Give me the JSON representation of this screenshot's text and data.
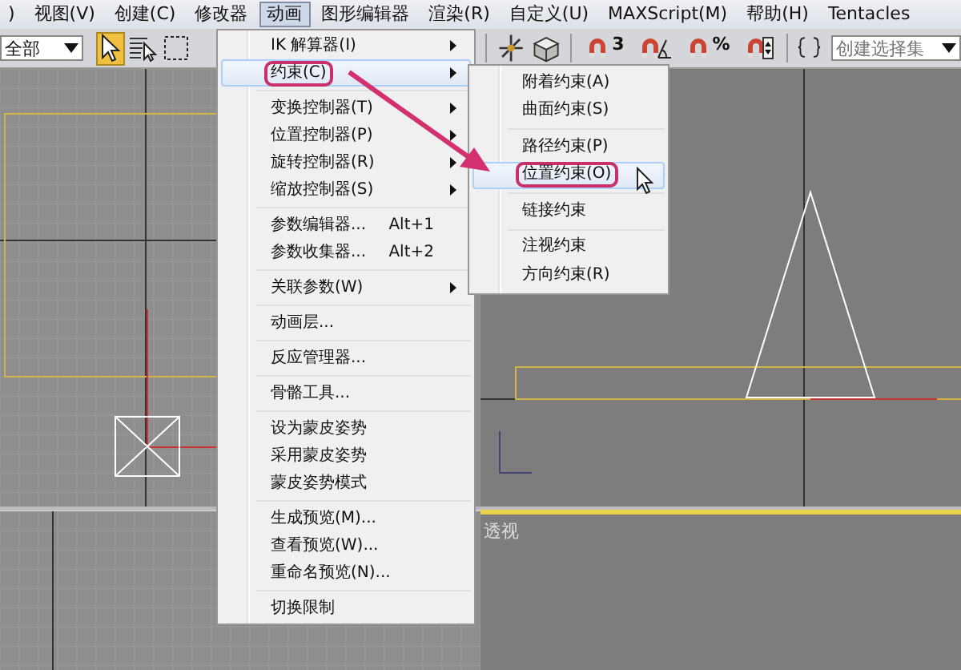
{
  "menubar": {
    "items": [
      {
        "label": ")",
        "selected": false
      },
      {
        "label": "视图(V)",
        "selected": false
      },
      {
        "label": "创建(C)",
        "selected": false
      },
      {
        "label": "修改器",
        "selected": false
      },
      {
        "label": "动画",
        "selected": true
      },
      {
        "label": "图形编辑器",
        "selected": false
      },
      {
        "label": "渲染(R)",
        "selected": false
      },
      {
        "label": "自定义(U)",
        "selected": false
      },
      {
        "label": "MAXScript(M)",
        "selected": false
      },
      {
        "label": "帮助(H)",
        "selected": false
      },
      {
        "label": "Tentacles",
        "selected": false
      }
    ]
  },
  "toolbar": {
    "selection_filter": "全部",
    "tools": [
      {
        "kind": "select",
        "selected": true
      },
      {
        "kind": "select-by-name",
        "selected": false
      },
      {
        "kind": "region",
        "selected": false
      }
    ],
    "snap_tools": [
      {
        "kind": "snap",
        "label": "3"
      },
      {
        "kind": "angle"
      },
      {
        "kind": "percent",
        "label": "%"
      },
      {
        "kind": "spinner"
      }
    ],
    "named_selection": {
      "placeholder": "创建选择集"
    }
  },
  "menu": {
    "items": [
      {
        "kind": "item",
        "label": "IK 解算器(I)",
        "submenu": true,
        "highlighted": false,
        "circled": false
      },
      {
        "kind": "item",
        "label": "约束(C)",
        "submenu": true,
        "highlighted": true,
        "circled": true
      },
      {
        "kind": "separator"
      },
      {
        "kind": "item",
        "label": "变换控制器(T)",
        "submenu": true,
        "highlighted": false,
        "circled": false
      },
      {
        "kind": "item",
        "label": "位置控制器(P)",
        "submenu": true,
        "highlighted": false,
        "circled": false
      },
      {
        "kind": "item",
        "label": "旋转控制器(R)",
        "submenu": true,
        "highlighted": false,
        "circled": false
      },
      {
        "kind": "item",
        "label": "缩放控制器(S)",
        "submenu": true,
        "highlighted": false,
        "circled": false
      },
      {
        "kind": "separator"
      },
      {
        "kind": "item",
        "label": "参数编辑器...",
        "shortcut": "Alt+1",
        "submenu": false,
        "highlighted": false,
        "circled": false
      },
      {
        "kind": "item",
        "label": "参数收集器...",
        "shortcut": "Alt+2",
        "submenu": false,
        "highlighted": false,
        "circled": false
      },
      {
        "kind": "separator"
      },
      {
        "kind": "item",
        "label": "关联参数(W)",
        "submenu": true,
        "highlighted": false,
        "circled": false
      },
      {
        "kind": "separator"
      },
      {
        "kind": "item",
        "label": "动画层...",
        "submenu": false,
        "highlighted": false,
        "circled": false
      },
      {
        "kind": "separator"
      },
      {
        "kind": "item",
        "label": "反应管理器...",
        "submenu": false,
        "highlighted": false,
        "circled": false
      },
      {
        "kind": "separator"
      },
      {
        "kind": "item",
        "label": "骨骼工具...",
        "submenu": false,
        "highlighted": false,
        "circled": false
      },
      {
        "kind": "separator"
      },
      {
        "kind": "item",
        "label": "设为蒙皮姿势",
        "submenu": false,
        "highlighted": false,
        "circled": false
      },
      {
        "kind": "item",
        "label": "采用蒙皮姿势",
        "submenu": false,
        "highlighted": false,
        "circled": false
      },
      {
        "kind": "item",
        "label": "蒙皮姿势模式",
        "submenu": false,
        "highlighted": false,
        "circled": false
      },
      {
        "kind": "separator"
      },
      {
        "kind": "item",
        "label": "生成预览(M)...",
        "submenu": false,
        "highlighted": false,
        "circled": false
      },
      {
        "kind": "item",
        "label": "查看预览(W)...",
        "submenu": false,
        "highlighted": false,
        "circled": false
      },
      {
        "kind": "item",
        "label": "重命名预览(N)...",
        "submenu": false,
        "highlighted": false,
        "circled": false
      },
      {
        "kind": "separator"
      },
      {
        "kind": "item",
        "label": "切换限制",
        "submenu": false,
        "highlighted": false,
        "circled": false
      }
    ]
  },
  "submenu": {
    "items": [
      {
        "kind": "item",
        "label": "附着约束(A)",
        "highlighted": false,
        "circled": false
      },
      {
        "kind": "item",
        "label": "曲面约束(S)",
        "highlighted": false,
        "circled": false
      },
      {
        "kind": "separator"
      },
      {
        "kind": "item",
        "label": "路径约束(P)",
        "highlighted": false,
        "circled": false
      },
      {
        "kind": "item",
        "label": "位置约束(O)",
        "highlighted": true,
        "circled": true
      },
      {
        "kind": "separator"
      },
      {
        "kind": "item",
        "label": "链接约束",
        "highlighted": false,
        "circled": false
      },
      {
        "kind": "separator"
      },
      {
        "kind": "item",
        "label": "注视约束",
        "highlighted": false,
        "circled": false
      },
      {
        "kind": "item",
        "label": "方向约束(R)",
        "highlighted": false,
        "circled": false
      }
    ]
  },
  "viewports": {
    "active_label": "透视"
  }
}
